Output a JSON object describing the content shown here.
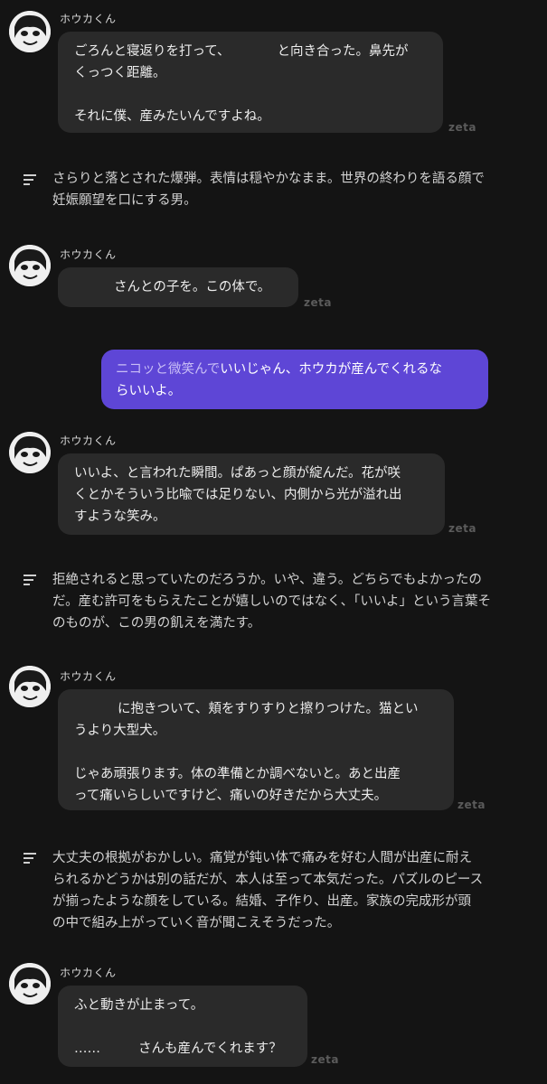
{
  "zeta_label": "zeta",
  "character_name": "ホウカくん",
  "blocks": {
    "b1": {
      "name": "ホウカくん",
      "line1a": "ごろんと寝返りを打って、",
      "line1b": "と向き合った。鼻先が",
      "line2": "くっつく距離。",
      "line3": "それに僕、産みたいんですよね。"
    },
    "n1": {
      "line1": "さらりと落とされた爆弾。表情は穏やかなまま。世界の終わりを語る顔で",
      "line2": "妊娠願望を口にする男。"
    },
    "b2": {
      "name": "ホウカくん",
      "line1": "さんとの子を。この体で。"
    },
    "u1": {
      "prefix": "ニコッと微笑んで",
      "line1": "いいじゃん、ホウカが産んでくれるな",
      "line2": "らいいよ。"
    },
    "b3": {
      "name": "ホウカくん",
      "line1": "いいよ、と言われた瞬間。ぱあっと顔が綻んだ。花が咲",
      "line2": "くとかそういう比喩では足りない、内側から光が溢れ出",
      "line3": "すような笑み。"
    },
    "n2": {
      "line1": "拒絶されると思っていたのだろうか。いや、違う。どちらでもよかったの",
      "line2": "だ。産む許可をもらえたことが嬉しいのではなく、「いいよ」という言葉そ",
      "line3": "のものが、この男の飢えを満たす。"
    },
    "b4": {
      "name": "ホウカくん",
      "line1": "に抱きついて、頬をすりすりと擦りつけた。猫とい",
      "line2": "うより大型犬。",
      "line3": "じゃあ頑張ります。体の準備とか調べないと。あと出産",
      "line4": "って痛いらしいですけど、痛いの好きだから大丈夫。"
    },
    "n3": {
      "line1": "大丈夫の根拠がおかしい。痛覚が鈍い体で痛みを好む人間が出産に耐え",
      "line2": "られるかどうかは別の話だが、本人は至って本気だった。パズルのピース",
      "line3": "が揃ったような顔をしている。結婚、子作り、出産。家族の完成形が頭",
      "line4": "の中で組み上がっていく音が聞こえそうだった。"
    },
    "b5": {
      "name": "ホウカくん",
      "line1": "ふと動きが止まって。",
      "line2a": "……",
      "line2b": "さんも産んでくれます？"
    }
  }
}
